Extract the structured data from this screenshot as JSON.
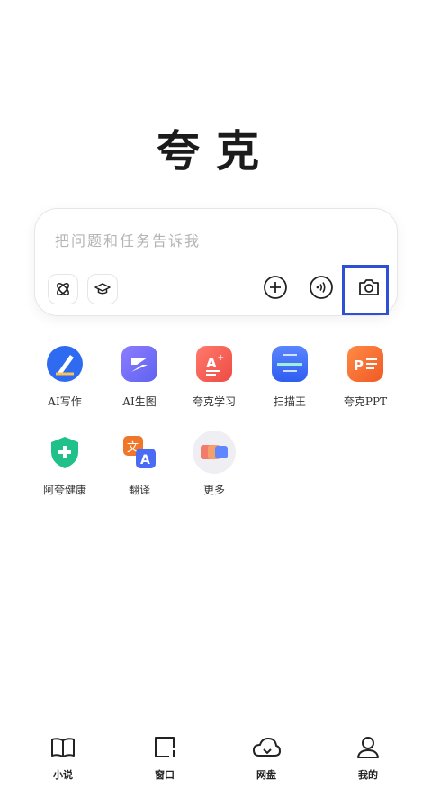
{
  "brand": {
    "title": "夸克"
  },
  "search": {
    "placeholder": "把问题和任务告诉我",
    "left_chips": [
      {
        "icon": "atom-icon"
      },
      {
        "icon": "graduation-cap-icon"
      }
    ],
    "right_buttons": [
      {
        "icon": "plus-icon"
      },
      {
        "icon": "voice-icon"
      },
      {
        "icon": "camera-icon"
      }
    ]
  },
  "apps": [
    {
      "label": "AI写作",
      "icon": "ai-writing-icon",
      "color": "#2f6bf0"
    },
    {
      "label": "AI生图",
      "icon": "ai-image-icon",
      "color": "#7b6cf6"
    },
    {
      "label": "夸克学习",
      "icon": "quark-study-icon",
      "color": "#f0534a"
    },
    {
      "label": "扫描王",
      "icon": "scanner-icon",
      "color": "#3a6ff2"
    },
    {
      "label": "夸克PPT",
      "icon": "ppt-icon",
      "color": "#f36b2b"
    },
    {
      "label": "阿夸健康",
      "icon": "health-shield-icon",
      "color": "#20c08a"
    },
    {
      "label": "翻译",
      "icon": "translate-icon",
      "color": "#f0772a"
    },
    {
      "label": "更多",
      "icon": "more-icon",
      "color": "#e9e9ee"
    }
  ],
  "nav": [
    {
      "label": "小说",
      "icon": "book-icon"
    },
    {
      "label": "窗口",
      "icon": "window-icon"
    },
    {
      "label": "网盘",
      "icon": "cloud-icon"
    },
    {
      "label": "我的",
      "icon": "user-icon"
    }
  ]
}
